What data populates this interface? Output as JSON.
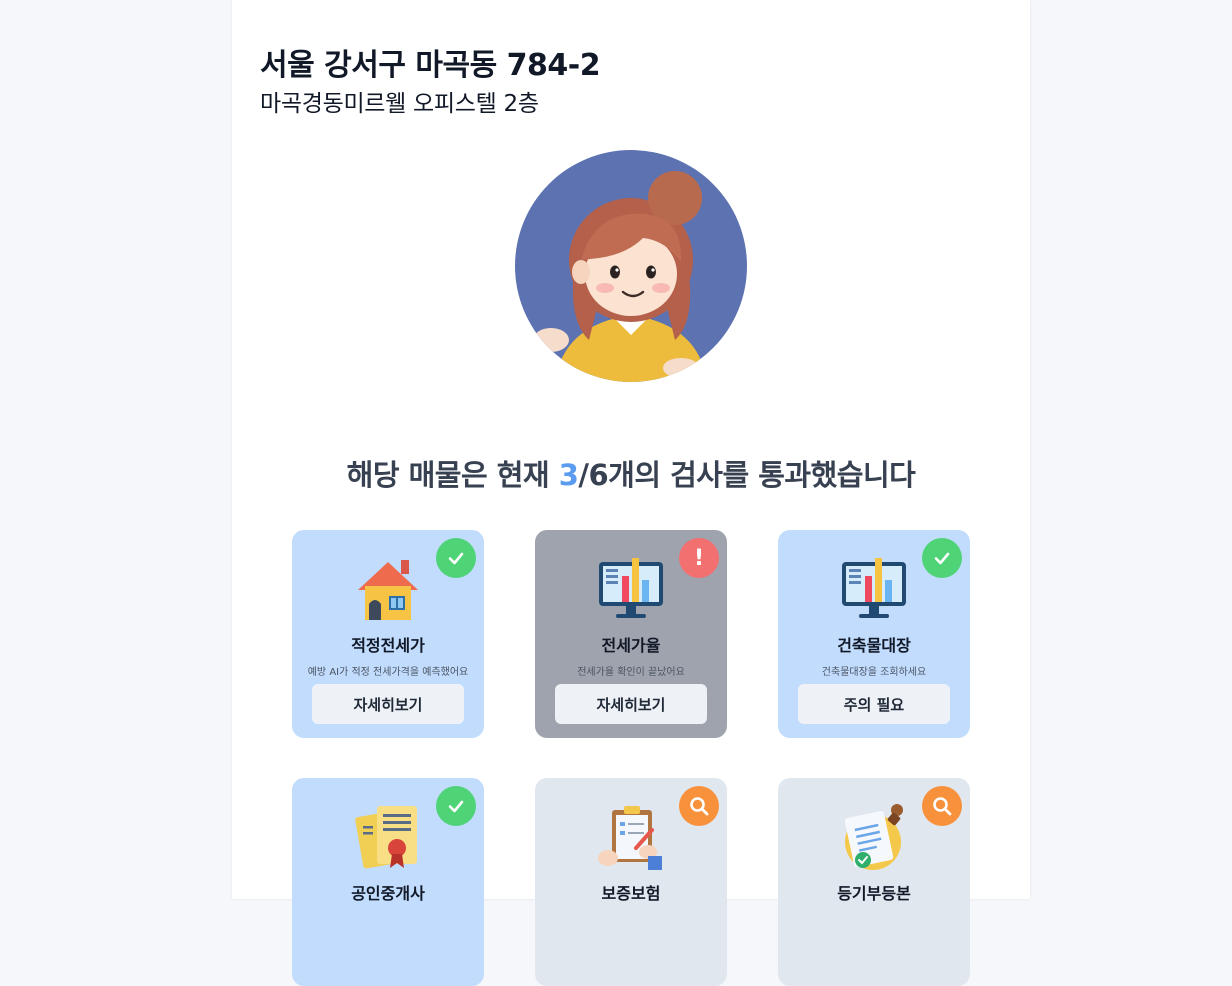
{
  "header": {
    "address": "서울 강서구 마곡동 784-2",
    "building": "마곡경동미르웰 오피스텔 2층"
  },
  "summary": {
    "prefix": "해당 매물은 현재 ",
    "passed": "3",
    "suffix": "/6개의 검사를 통과했습니다"
  },
  "cards": [
    {
      "label": "적정전세가",
      "desc": "예방 AI가 적정 전세가격을 예측했어요",
      "button": "자세히보기",
      "status": "pass",
      "icon": "house-icon"
    },
    {
      "label": "전세가율",
      "desc": "전세가율 확인이 끝났어요",
      "button": "자세히보기",
      "status": "warning",
      "icon": "monitor-chart-icon"
    },
    {
      "label": "건축물대장",
      "desc": "건축물대장을 조회하세요",
      "button": "주의 필요",
      "status": "pass",
      "icon": "monitor-chart-icon"
    },
    {
      "label": "공인중개사",
      "desc": "",
      "button": "",
      "status": "pass",
      "icon": "certificate-icon"
    },
    {
      "label": "보증보험",
      "desc": "",
      "button": "",
      "status": "checking",
      "icon": "clipboard-icon"
    },
    {
      "label": "등기부등본",
      "desc": "",
      "button": "",
      "status": "checking",
      "icon": "document-stamp-icon"
    }
  ],
  "colors": {
    "pass_card": "#c1dcfd",
    "warn_card": "#9ea3ad",
    "check_card": "#e1e7ef",
    "pass_badge": "#4fd377",
    "warn_badge": "#f27070",
    "check_badge": "#f7913c",
    "accent": "#5b9bf0"
  }
}
